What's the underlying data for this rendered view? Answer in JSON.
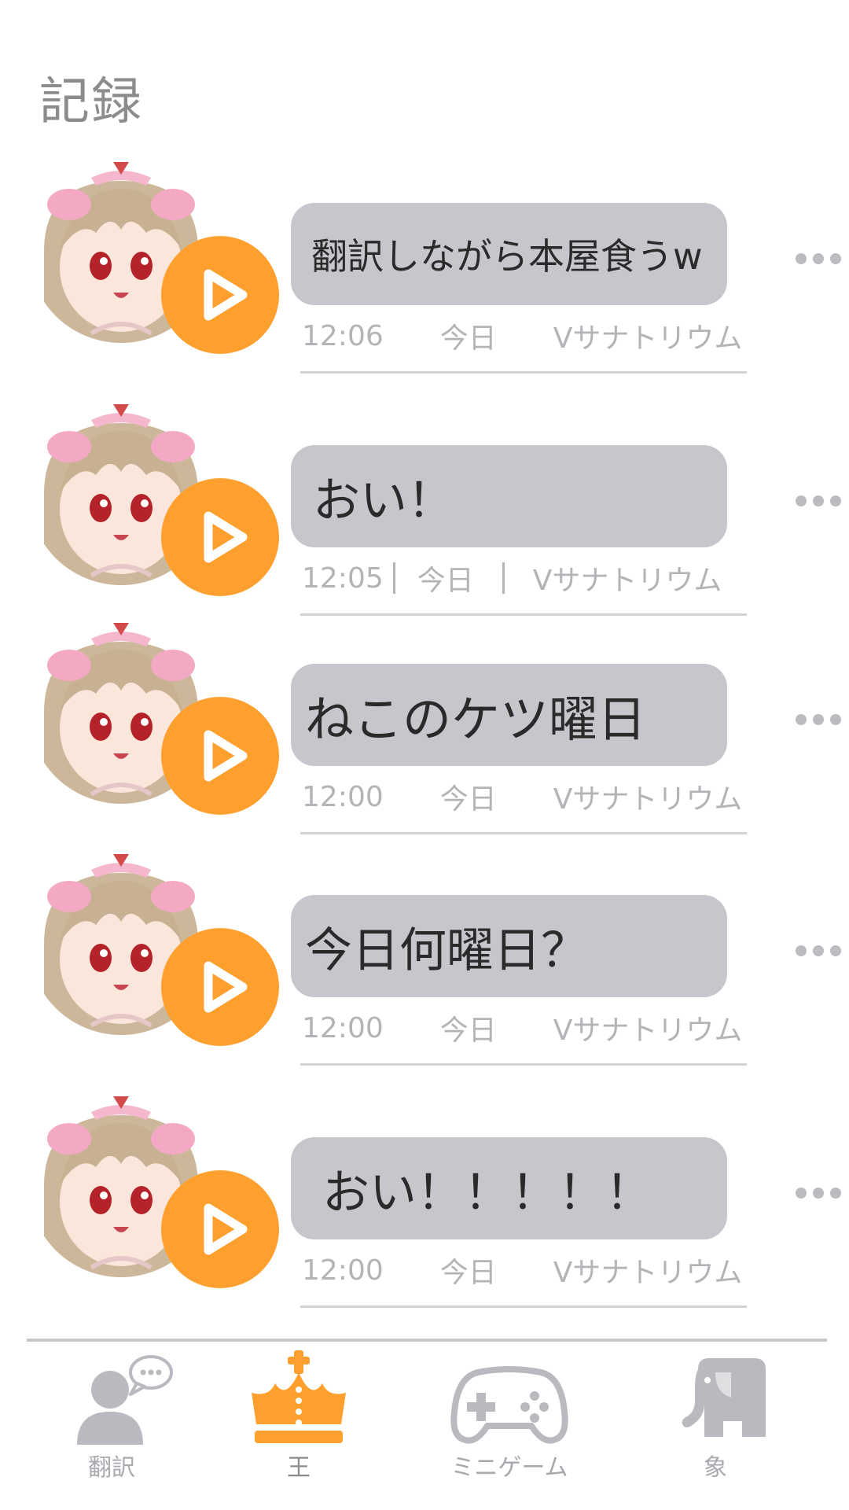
{
  "page": {
    "title": "記録"
  },
  "colors": {
    "accent": "#ffa02e",
    "bubble": "#c6c6cc",
    "meta_text": "#b4b4b8",
    "title_text": "#8c8c8c"
  },
  "records": [
    {
      "message": "翻訳しながら本屋食うw",
      "time": "12:06",
      "day": "今日",
      "server": "Vサナトリウム"
    },
    {
      "message": "おい！",
      "time": "12:05",
      "day": "今日",
      "server": "Vサナトリウム"
    },
    {
      "message": "ねこのケツ曜日",
      "time": "12:00",
      "day": "今日",
      "server": "Vサナトリウム"
    },
    {
      "message": "今日何曜日？",
      "time": "12:00",
      "day": "今日",
      "server": "Vサナトリウム"
    },
    {
      "message": "おい！！！！！",
      "time": "12:00",
      "day": "今日",
      "server": "Vサナトリウム"
    }
  ],
  "tabs": [
    {
      "label": "翻訳",
      "icon": "person-chat-icon",
      "active": false
    },
    {
      "label": "王",
      "icon": "crown-icon",
      "active": true
    },
    {
      "label": "ミニゲーム",
      "icon": "gamepad-icon",
      "active": false
    },
    {
      "label": "象",
      "icon": "elephant-icon",
      "active": false
    }
  ]
}
